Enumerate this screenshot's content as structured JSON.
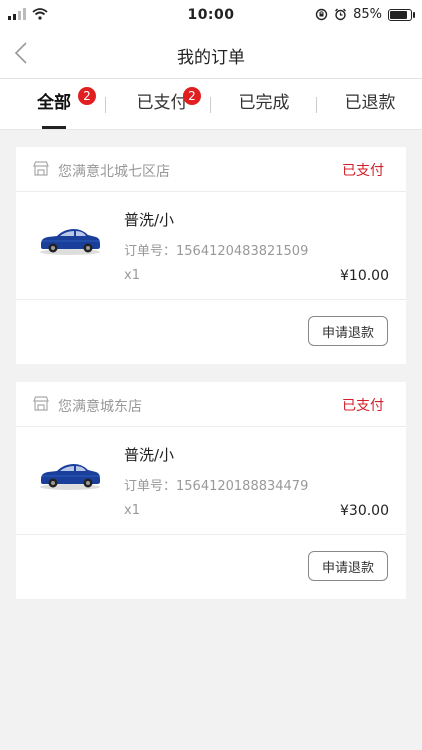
{
  "status_bar": {
    "time": "10:00",
    "battery": "85%",
    "battery_level": 0.85
  },
  "nav": {
    "title": "我的订单"
  },
  "tabs": [
    {
      "label": "全部",
      "badge": "2",
      "active": true
    },
    {
      "label": "已支付",
      "badge": "2",
      "active": false
    },
    {
      "label": "已完成",
      "badge": "",
      "active": false
    },
    {
      "label": "已退款",
      "badge": "",
      "active": false
    }
  ],
  "orders": [
    {
      "shop": "您满意北城七区店",
      "status": "已支付",
      "product": "普洗/小",
      "order_no": "订单号：1564120483821509",
      "qty": "x1",
      "price": "¥10.00",
      "refund_label": "申请退款"
    },
    {
      "shop": "您满意城东店",
      "status": "已支付",
      "product": "普洗/小",
      "order_no": "订单号：1564120188834479",
      "qty": "x1",
      "price": "¥30.00",
      "refund_label": "申请退款"
    }
  ],
  "colors": {
    "accent_red": "#d0202a",
    "badge_red": "#e02020",
    "car_blue": "#1a3f9a"
  }
}
